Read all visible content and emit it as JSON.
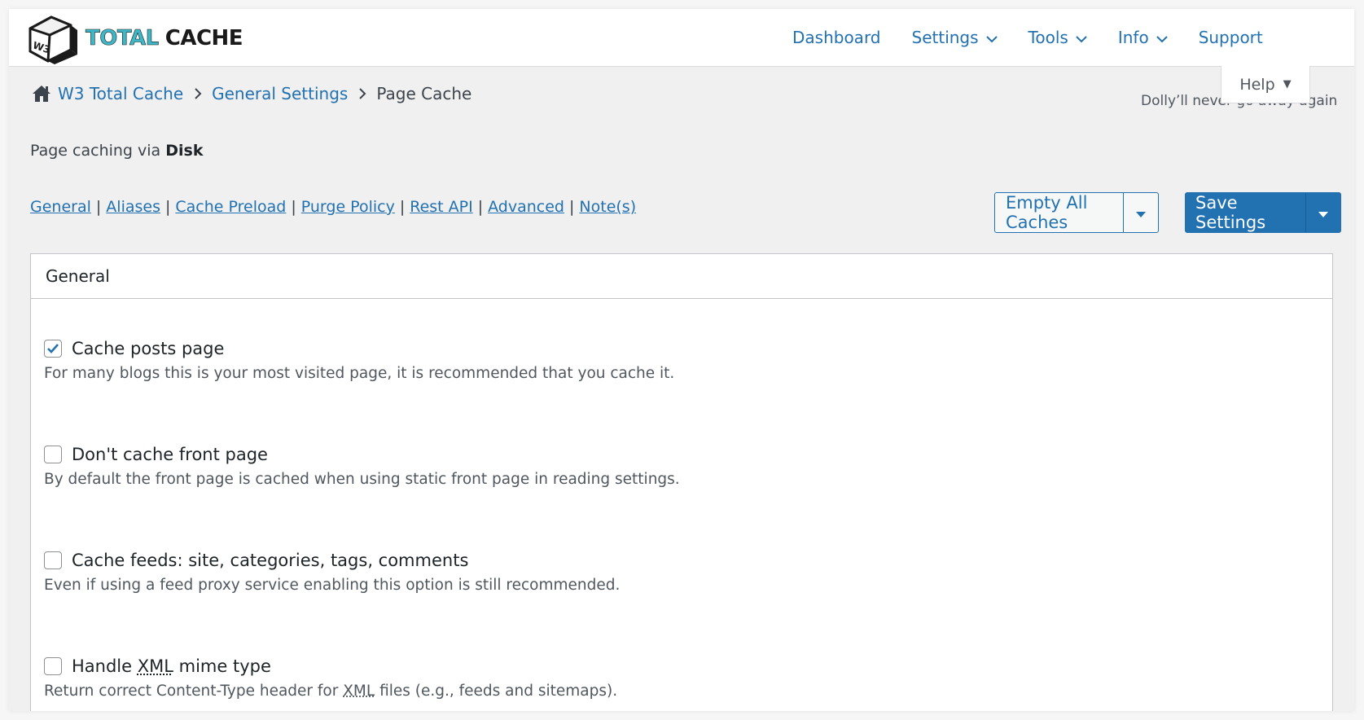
{
  "logo": {
    "word1": "TOTAL",
    "word2": "CACHE",
    "cube_text": "W3"
  },
  "nav": [
    {
      "label": "Dashboard",
      "has_dropdown": false
    },
    {
      "label": "Settings",
      "has_dropdown": true
    },
    {
      "label": "Tools",
      "has_dropdown": true
    },
    {
      "label": "Info",
      "has_dropdown": true
    },
    {
      "label": "Support",
      "has_dropdown": false
    }
  ],
  "help": {
    "label": "Help"
  },
  "dolly": {
    "text": "Dolly’ll never go away again"
  },
  "breadcrumb": [
    {
      "label": "W3 Total Cache",
      "link": true
    },
    {
      "label": "General Settings",
      "link": true
    },
    {
      "label": "Page Cache",
      "link": false
    }
  ],
  "caching_via": {
    "prefix": "Page caching via ",
    "method": "Disk"
  },
  "sublinks": [
    "General",
    "Aliases",
    "Cache Preload",
    "Purge Policy",
    "Rest API",
    "Advanced",
    "Note(s)"
  ],
  "buttons": {
    "empty_all": "Empty All Caches",
    "save": "Save Settings"
  },
  "section": {
    "title": "General",
    "options": [
      {
        "label": "Cache posts page",
        "checked": true,
        "desc": "For many blogs this is your most visited page, it is recommended that you cache it."
      },
      {
        "label": "Don't cache front page",
        "checked": false,
        "desc": "By default the front page is cached when using static front page in reading settings."
      },
      {
        "label": "Cache feeds: site, categories, tags, comments",
        "checked": false,
        "desc": "Even if using a feed proxy service enabling this option is still recommended."
      },
      {
        "label_pre": "Handle ",
        "label_abbr": "XML",
        "label_post": " mime type",
        "checked": false,
        "desc_pre": "Return correct Content-Type header for ",
        "desc_abbr": "XML",
        "desc_post": " files (e.g., feeds and sitemaps)."
      }
    ]
  },
  "colors": {
    "link": "#2271b1",
    "logo_teal": "#3fb7c7",
    "primary_button": "#2271b1"
  }
}
